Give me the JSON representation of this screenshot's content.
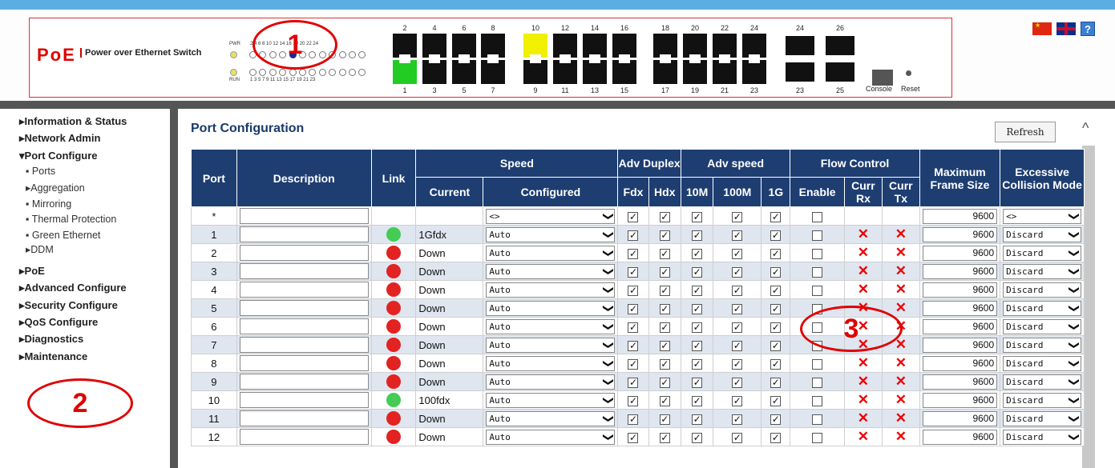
{
  "header": {
    "logo": "PoE",
    "logo_sub": "Power over Ethernet Switch",
    "pwr_label": "PWR",
    "run_label": "RUN",
    "led_top_nums": "2  4  6  8 10 12 14 16 18 20 22 24",
    "led_bot_nums": "1  3  5  7  9 11 13 15 17 19 21 23",
    "ports_top_labels": [
      "2",
      "4",
      "6",
      "8",
      "10",
      "12",
      "14",
      "16",
      "18",
      "20",
      "22",
      "24"
    ],
    "ports_bot_labels": [
      "1",
      "3",
      "5",
      "7",
      "9",
      "11",
      "13",
      "15",
      "17",
      "19",
      "21",
      "23"
    ],
    "sfp_top_labels": [
      "24",
      "26"
    ],
    "sfp_bot_labels": [
      "23",
      "25"
    ],
    "console_label": "Console",
    "reset_label": "Reset",
    "help_glyph": "?"
  },
  "annotations": {
    "a1": "1",
    "a2": "2",
    "a3": "3"
  },
  "sidebar": {
    "items": [
      {
        "label": "▸Information & Status"
      },
      {
        "label": "▸Network Admin"
      },
      {
        "label": "▾Port Configure"
      },
      {
        "label": "▪ Ports"
      },
      {
        "label": "▸Aggregation"
      },
      {
        "label": "▪ Mirroring"
      },
      {
        "label": "▪ Thermal Protection"
      },
      {
        "label": "▪ Green Ethernet"
      },
      {
        "label": "▸DDM"
      },
      {
        "label": "▸PoE"
      },
      {
        "label": "▸Advanced Configure"
      },
      {
        "label": "▸Security Configure"
      },
      {
        "label": "▸QoS Configure"
      },
      {
        "label": "▸Diagnostics"
      },
      {
        "label": "▸Maintenance"
      }
    ]
  },
  "main": {
    "title": "Port Configuration",
    "refresh_label": "Refresh",
    "headers": {
      "port": "Port",
      "description": "Description",
      "link": "Link",
      "speed": "Speed",
      "current": "Current",
      "configured": "Configured",
      "adv_duplex": "Adv Duplex",
      "fdx": "Fdx",
      "hdx": "Hdx",
      "adv_speed": "Adv speed",
      "s10m": "10M",
      "s100m": "100M",
      "s1g": "1G",
      "flow_control": "Flow Control",
      "enable": "Enable",
      "curr_rx": "Curr Rx",
      "curr_tx": "Curr Tx",
      "max_frame": "Maximum Frame Size",
      "excessive": "Excessive Collision Mode"
    },
    "wildcard_row": {
      "port": "*",
      "configured": "<>",
      "frame": "9600",
      "excessive": "<>"
    },
    "rows": [
      {
        "port": "1",
        "link": "green",
        "current": "1Gfdx",
        "configured": "Auto",
        "frame": "9600",
        "excessive": "Discard"
      },
      {
        "port": "2",
        "link": "red",
        "current": "Down",
        "configured": "Auto",
        "frame": "9600",
        "excessive": "Discard"
      },
      {
        "port": "3",
        "link": "red",
        "current": "Down",
        "configured": "Auto",
        "frame": "9600",
        "excessive": "Discard"
      },
      {
        "port": "4",
        "link": "red",
        "current": "Down",
        "configured": "Auto",
        "frame": "9600",
        "excessive": "Discard"
      },
      {
        "port": "5",
        "link": "red",
        "current": "Down",
        "configured": "Auto",
        "frame": "9600",
        "excessive": "Discard"
      },
      {
        "port": "6",
        "link": "red",
        "current": "Down",
        "configured": "Auto",
        "frame": "9600",
        "excessive": "Discard"
      },
      {
        "port": "7",
        "link": "red",
        "current": "Down",
        "configured": "Auto",
        "frame": "9600",
        "excessive": "Discard"
      },
      {
        "port": "8",
        "link": "red",
        "current": "Down",
        "configured": "Auto",
        "frame": "9600",
        "excessive": "Discard"
      },
      {
        "port": "9",
        "link": "red",
        "current": "Down",
        "configured": "Auto",
        "frame": "9600",
        "excessive": "Discard"
      },
      {
        "port": "10",
        "link": "green",
        "current": "100fdx",
        "configured": "Auto",
        "frame": "9600",
        "excessive": "Discard"
      },
      {
        "port": "11",
        "link": "red",
        "current": "Down",
        "configured": "Auto",
        "frame": "9600",
        "excessive": "Discard"
      },
      {
        "port": "12",
        "link": "red",
        "current": "Down",
        "configured": "Auto",
        "frame": "9600",
        "excessive": "Discard"
      }
    ]
  },
  "colors": {
    "header_bg": "#1e3e72",
    "row_alt": "#dfe6f0",
    "link_up": "#44cc55",
    "link_down": "#e32222",
    "accent": "#e00000"
  }
}
